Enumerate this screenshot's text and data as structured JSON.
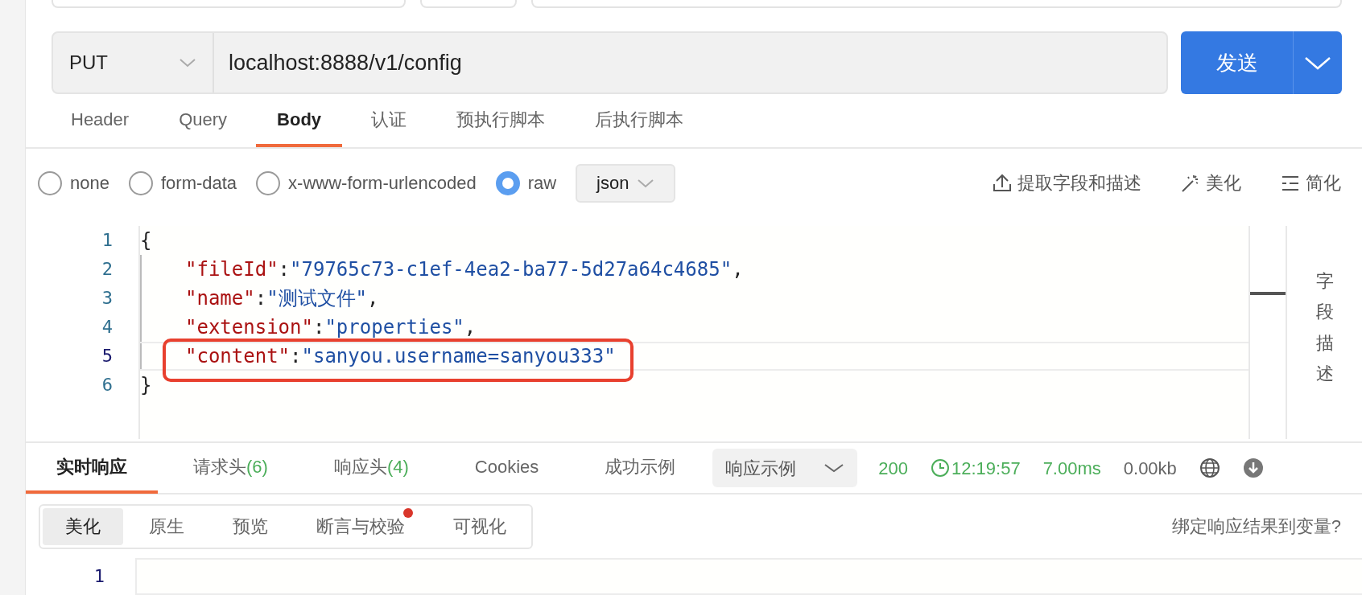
{
  "request": {
    "method": "PUT",
    "url": "localhost:8888/v1/config",
    "send_button": "发送"
  },
  "request_tabs": [
    {
      "label": "Header",
      "selected": false
    },
    {
      "label": "Query",
      "selected": false
    },
    {
      "label": "Body",
      "selected": true
    },
    {
      "label": "认证",
      "selected": false
    },
    {
      "label": "预执行脚本",
      "selected": false
    },
    {
      "label": "后执行脚本",
      "selected": false
    }
  ],
  "body_types": [
    {
      "label": "none",
      "selected": false
    },
    {
      "label": "form-data",
      "selected": false
    },
    {
      "label": "x-www-form-urlencoded",
      "selected": false
    },
    {
      "label": "raw",
      "selected": true
    }
  ],
  "body_format": "json",
  "body_actions": [
    {
      "kind": "extract",
      "label": "提取字段和描述"
    },
    {
      "kind": "beautify",
      "label": "美化"
    },
    {
      "kind": "simplify",
      "label": "简化"
    }
  ],
  "editor": {
    "lines": [
      {
        "number": "1",
        "active": false,
        "tokens": [
          {
            "kind": "punct",
            "text": "{"
          }
        ]
      },
      {
        "number": "2",
        "active": false,
        "tokens": [
          {
            "kind": "key",
            "text": "\"fileId\""
          },
          {
            "kind": "punct",
            "text": ":"
          },
          {
            "kind": "string",
            "text": "\"79765c73-c1ef-4ea2-ba77-5d27a64c4685\""
          },
          {
            "kind": "punct",
            "text": ","
          }
        ]
      },
      {
        "number": "3",
        "active": false,
        "tokens": [
          {
            "kind": "key",
            "text": "\"name\""
          },
          {
            "kind": "punct",
            "text": ":"
          },
          {
            "kind": "string",
            "text": "\"测试文件\""
          },
          {
            "kind": "punct",
            "text": ","
          }
        ]
      },
      {
        "number": "4",
        "active": false,
        "tokens": [
          {
            "kind": "key",
            "text": "\"extension\""
          },
          {
            "kind": "punct",
            "text": ":"
          },
          {
            "kind": "string",
            "text": "\"properties\""
          },
          {
            "kind": "punct",
            "text": ","
          }
        ]
      },
      {
        "number": "5",
        "active": true,
        "highlighted": true,
        "tokens": [
          {
            "kind": "key",
            "text": "\"content\""
          },
          {
            "kind": "punct",
            "text": ":"
          },
          {
            "kind": "string",
            "text": "\"sanyou.username=sanyou333\""
          }
        ]
      },
      {
        "number": "6",
        "active": false,
        "tokens": [
          {
            "kind": "punct",
            "text": "}"
          }
        ]
      }
    ],
    "side_panel": "字段描述"
  },
  "response_tabs": [
    {
      "label": "实时响应",
      "selected": true
    },
    {
      "label": "请求头",
      "count": "(6)",
      "selected": false
    },
    {
      "label": "响应头",
      "count": "(4)",
      "selected": false
    },
    {
      "label": "Cookies",
      "selected": false
    },
    {
      "label": "成功示例",
      "selected": false
    }
  ],
  "example_dropdown": "响应示例",
  "status": {
    "code": "200",
    "time": "12:19:57",
    "duration": "7.00ms",
    "size": "0.00kb"
  },
  "view_tabs": [
    {
      "label": "美化",
      "selected": true,
      "dot": false
    },
    {
      "label": "原生",
      "selected": false,
      "dot": false
    },
    {
      "label": "预览",
      "selected": false,
      "dot": false
    },
    {
      "label": "断言与校验",
      "selected": false,
      "dot": true
    },
    {
      "label": "可视化",
      "selected": false,
      "dot": false
    }
  ],
  "bind_link": "绑定响应结果到变量?",
  "response_editor": {
    "lines": [
      "1"
    ]
  }
}
